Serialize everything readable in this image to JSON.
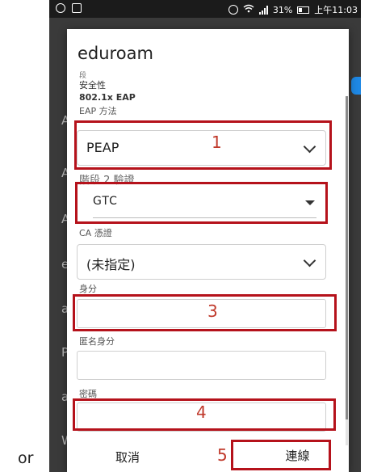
{
  "status_bar": {
    "battery_text": "31%",
    "time": "上午11:03"
  },
  "background_letters": [
    "A",
    "A",
    "A",
    "e",
    "a",
    "P",
    "a",
    "W"
  ],
  "dialog": {
    "title": "eduroam",
    "cut_label": "段",
    "security_label": "安全性",
    "security_value": "802.1x EAP",
    "eap_method_label": "EAP 方法",
    "eap_method_value": "PEAP",
    "phase2_label": "階段 2 驗證",
    "phase2_value": "GTC",
    "ca_cert_label": "CA 憑證",
    "ca_cert_value": "(未指定)",
    "identity_label": "身分",
    "anon_identity_label": "匿名身分",
    "password_label": "密碼",
    "cancel_label": "取消",
    "connect_label": "連線"
  },
  "annotations": {
    "n1": "1",
    "n3": "3",
    "n4": "4",
    "n5": "5"
  },
  "caption": "or",
  "colors": {
    "annotation_red": "#b5121b",
    "accent_blue": "#1e88e5"
  }
}
